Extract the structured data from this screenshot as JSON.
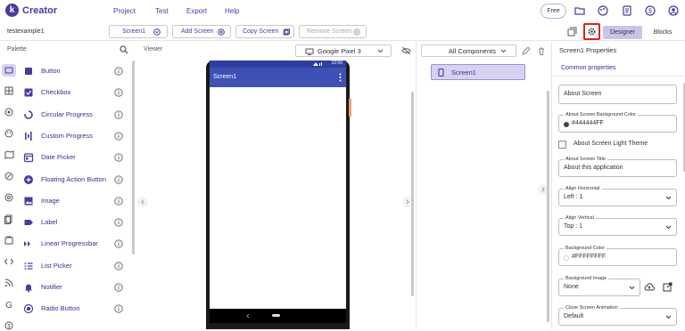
{
  "app": {
    "logo_letter": "k",
    "name": "Creator"
  },
  "menu": [
    "Project",
    "Test",
    "Export",
    "Help"
  ],
  "free_label": "Free",
  "project_name": "testexample1",
  "screen_selector": {
    "label": "Screen1"
  },
  "toolbar": {
    "add_screen": "Add Screen",
    "copy_screen": "Copy Screen",
    "remove_screen": "Remove Screen"
  },
  "view_tabs": {
    "designer": "Designer",
    "blocks": "Blocks"
  },
  "palette": {
    "title": "Palette",
    "items": [
      {
        "label": "Button",
        "icon": "button-icon"
      },
      {
        "label": "Checkbox",
        "icon": "checkbox-icon"
      },
      {
        "label": "Circular Progress",
        "icon": "circular-progress-icon"
      },
      {
        "label": "Custom Progress",
        "icon": "custom-progress-icon"
      },
      {
        "label": "Date Picker",
        "icon": "date-picker-icon"
      },
      {
        "label": "Floating Action Button",
        "icon": "fab-icon"
      },
      {
        "label": "Image",
        "icon": "image-icon"
      },
      {
        "label": "Label",
        "icon": "label-icon"
      },
      {
        "label": "Linear Progressbar",
        "icon": "linear-progress-icon"
      },
      {
        "label": "List Picker",
        "icon": "list-picker-icon"
      },
      {
        "label": "Notifier",
        "icon": "bell-icon"
      },
      {
        "label": "Radio Button",
        "icon": "radio-icon"
      }
    ]
  },
  "viewer": {
    "title": "Viewer",
    "device": "Google Pixel 3",
    "status_time": "12:00",
    "screen_title": "Screen1"
  },
  "components": {
    "selector": "All Components",
    "tree": [
      "Screen1"
    ]
  },
  "properties": {
    "title": "Screen1 Properties",
    "common": "Common properties",
    "about_screen": "About Screen",
    "bg_color_label": "About Screen Background Color",
    "bg_color_value": "#444444FF",
    "light_theme": "About Screen Light Theme",
    "title_label": "About Screen Title",
    "title_value": "About this application",
    "align_h_label": "Align Horizontal",
    "align_h_value": "Left : 1",
    "align_v_label": "Align Vertical",
    "align_v_value": "Top : 1",
    "background_color_label": "Background Color",
    "background_color_value": "#FFFFFFFF",
    "background_image_label": "Background Image",
    "background_image_value": "None",
    "close_anim_label": "Close Screen Animation",
    "close_anim_value": "Default"
  },
  "colors": {
    "brand": "#4a3b9c",
    "appbar": "#3f51b5",
    "highlight": "#e02020",
    "selected": "#d7d2f0"
  }
}
